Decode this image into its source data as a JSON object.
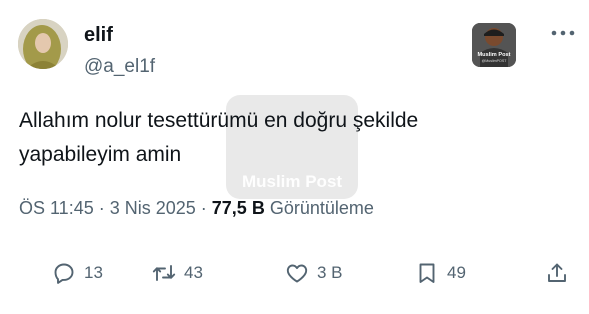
{
  "tweet": {
    "author_name": "elif",
    "author_handle": "@a_el1f",
    "text_line1": "Allahım nolur tesettürümü en doğru şekilde",
    "text_line2": "yapabileyim amin",
    "time": "ÖS 11:45",
    "date": "3 Nis 2025",
    "views_count": "77,5 B",
    "views_label": "Görüntüleme"
  },
  "affiliate_badge": {
    "name": "Muslim Post",
    "sub": "@MuslimPOST"
  },
  "watermark": {
    "name": "Muslim Post"
  },
  "actions": {
    "replies": "13",
    "reposts": "43",
    "likes": "3 B",
    "bookmarks": "49"
  },
  "icons": [
    "more-icon",
    "reply-icon",
    "repost-icon",
    "like-icon",
    "bookmark-icon",
    "share-icon"
  ],
  "colors": {
    "text": "#0f1419",
    "secondary": "#536471"
  }
}
